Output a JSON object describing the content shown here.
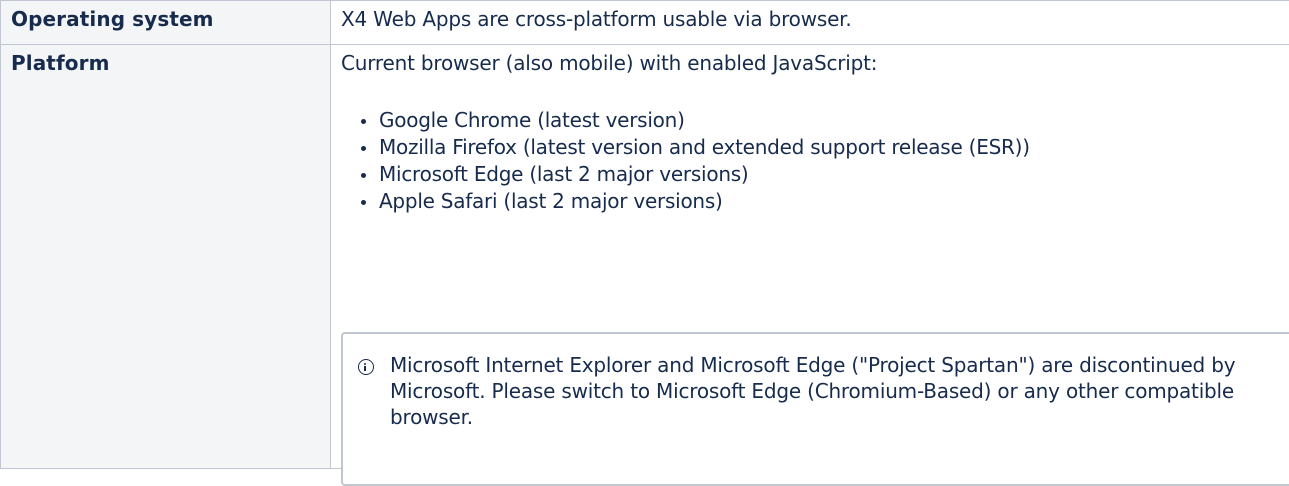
{
  "rows": [
    {
      "label": "Operating system",
      "value": "X4 Web Apps are cross-platform usable via browser."
    },
    {
      "label": "Platform",
      "intro": "Current browser (also mobile) with enabled JavaScript:",
      "browsers": [
        "Google Chrome (latest version)",
        "Mozilla Firefox (latest version and extended support release (ESR))",
        "Microsoft Edge (last 2 major versions)",
        "Apple Safari (last 2 major versions)"
      ],
      "info_icon": "info-icon",
      "info_note": "Microsoft Internet Explorer and Microsoft Edge (\"Project Spartan\") are discontinued by Microsoft. Please switch to Microsoft Edge (Chromium-Based) or any other compatible browser."
    }
  ]
}
